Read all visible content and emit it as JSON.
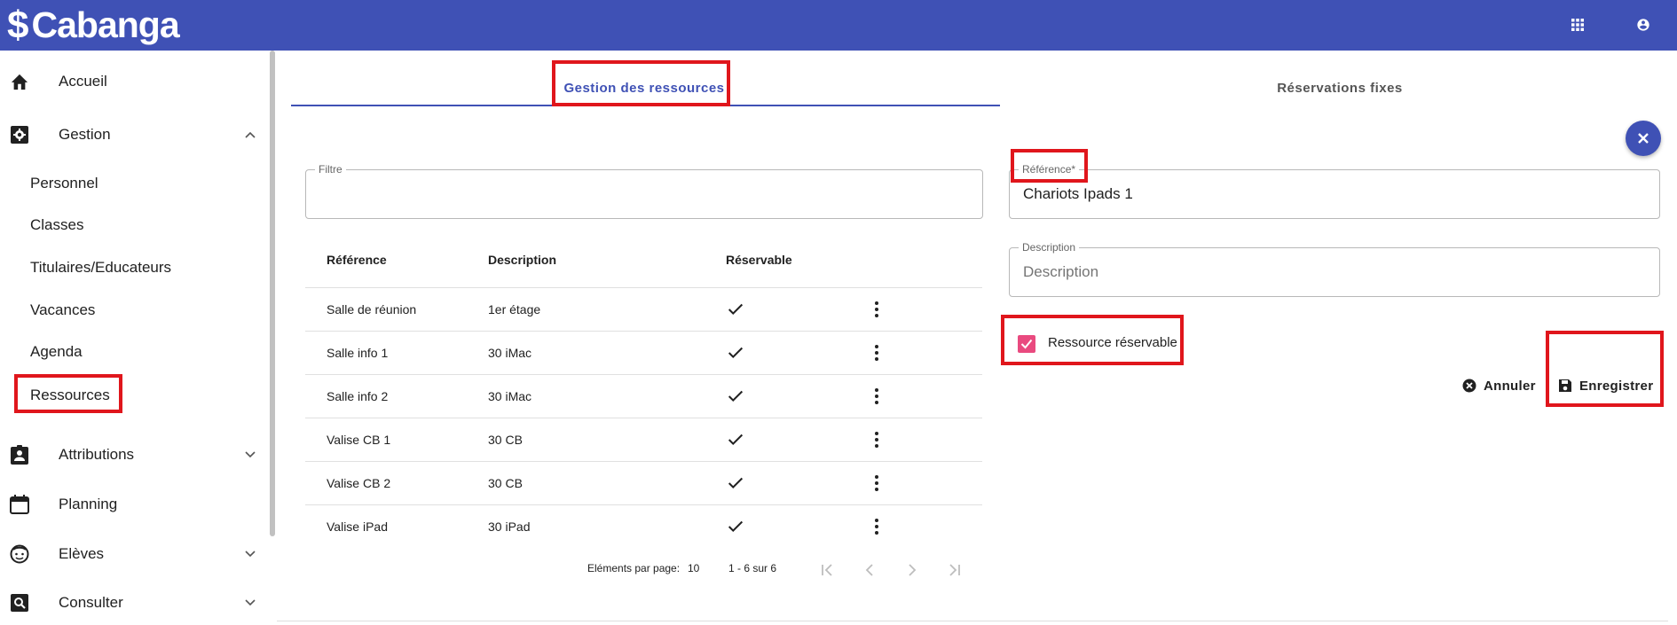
{
  "app": {
    "brand": "Cabanga",
    "brand_symbol": "$"
  },
  "colors": {
    "primary": "#3f51b5",
    "accent": "#e94a7f",
    "highlight": "#e0161c"
  },
  "topbar": {
    "icons": [
      "apps-grid-icon",
      "account-circle-icon"
    ]
  },
  "sidebar": {
    "accueil": "Accueil",
    "gestion": "Gestion",
    "gestion_children": [
      "Personnel",
      "Classes",
      "Titulaires/Educateurs",
      "Vacances",
      "Agenda",
      "Ressources"
    ],
    "attributions": "Attributions",
    "planning": "Planning",
    "eleves": "Elèves",
    "consulter": "Consulter"
  },
  "tabs": {
    "active": "Gestion des ressources",
    "inactive": "Réservations fixes"
  },
  "filter": {
    "legend": "Filtre",
    "value": ""
  },
  "table": {
    "headers": {
      "reference": "Référence",
      "description": "Description",
      "reservable": "Réservable"
    },
    "rows": [
      {
        "reference": "Salle de réunion",
        "description": "1er étage",
        "reservable": true
      },
      {
        "reference": "Salle info 1",
        "description": "30 iMac",
        "reservable": true
      },
      {
        "reference": "Salle info 2",
        "description": "30 iMac",
        "reservable": true
      },
      {
        "reference": "Valise CB 1",
        "description": "30 CB",
        "reservable": true
      },
      {
        "reference": "Valise CB 2",
        "description": "30 CB",
        "reservable": true
      },
      {
        "reference": "Valise iPad",
        "description": "30 iPad",
        "reservable": true
      }
    ]
  },
  "pagination": {
    "per_page_label": "Eléments par page:",
    "per_page": "10",
    "range": "1 - 6 sur 6"
  },
  "form": {
    "reference_legend": "Référence*",
    "reference_value": "Chariots Ipads 1",
    "description_legend": "Description",
    "description_placeholder": "Description",
    "reservable_label": "Ressource réservable",
    "reservable_checked": true,
    "cancel_label": "Annuler",
    "save_label": "Enregistrer"
  }
}
